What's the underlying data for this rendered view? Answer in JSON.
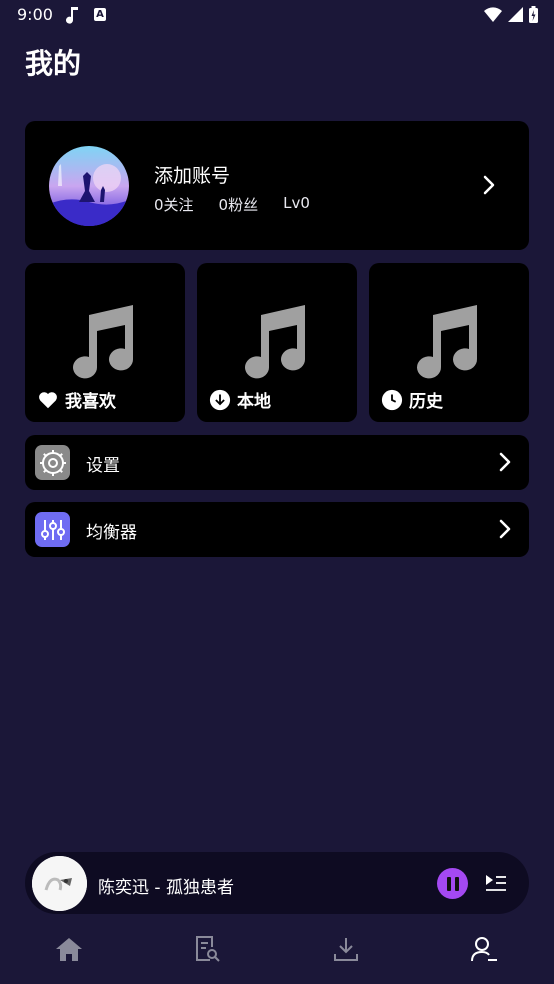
{
  "status_bar": {
    "time": "9:00",
    "notification_letter": "A"
  },
  "page": {
    "title": "我的"
  },
  "account": {
    "name": "添加账号",
    "following": "0关注",
    "followers": "0粉丝",
    "level": "Lv0"
  },
  "tiles": [
    {
      "label": "我喜欢",
      "icon": "heart-icon"
    },
    {
      "label": "本地",
      "icon": "download-icon"
    },
    {
      "label": "历史",
      "icon": "clock-icon"
    }
  ],
  "rows": [
    {
      "label": "设置",
      "icon": "gear-icon",
      "icon_color": "#8a8a8a"
    },
    {
      "label": "均衡器",
      "icon": "equalizer-icon",
      "icon_color": "#6f6cf2"
    }
  ],
  "player": {
    "now_playing": "陈奕迅 - 孤独患者",
    "pause_color": "#a449f2"
  },
  "bottom_nav": [
    {
      "name": "home",
      "icon": "home-icon",
      "active": false
    },
    {
      "name": "search-doc",
      "icon": "document-search-icon",
      "active": false
    },
    {
      "name": "download",
      "icon": "download-tray-icon",
      "active": false
    },
    {
      "name": "profile",
      "icon": "user-icon",
      "active": true
    }
  ],
  "colors": {
    "background": "#1b1738",
    "card": "#000000",
    "accent": "#a449f2"
  }
}
